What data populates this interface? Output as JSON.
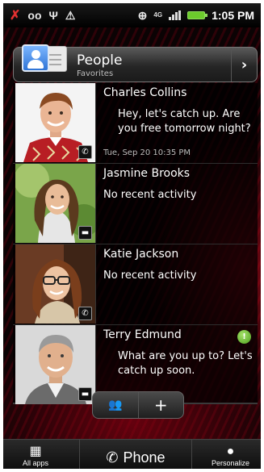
{
  "status_bar": {
    "network_label": "4G",
    "time": "1:05 PM",
    "icons": [
      "missed-call-icon",
      "voicemail-icon",
      "usb-icon",
      "warning-icon",
      "gps-icon",
      "signal-icon",
      "battery-icon"
    ]
  },
  "header": {
    "title": "People",
    "subtitle": "Favorites",
    "icon": "people-app-icon",
    "chevron": "›"
  },
  "contacts": [
    {
      "name": "Charles Collins",
      "message": "Hey, let's catch up. Are you free tomorrow night?",
      "timestamp": "Tue, Sep 20 10:35 PM",
      "badge_icon": "phone-badge-icon",
      "badge_glyph": "✆"
    },
    {
      "name": "Jasmine Brooks",
      "message": "No recent activity",
      "badge_icon": "message-badge-icon",
      "badge_glyph": "▬"
    },
    {
      "name": "Katie Jackson",
      "message": "No recent activity",
      "badge_icon": "phone-badge-icon",
      "badge_glyph": "✆"
    },
    {
      "name": "Terry Edmund",
      "message": "What are you up to? Let's catch up soon.",
      "new_indicator": "!",
      "badge_icon": "message-badge-icon",
      "badge_glyph": "▬"
    }
  ],
  "widget_buttons": {
    "groups_glyph": "👥",
    "add_glyph": "+"
  },
  "launcher": {
    "all_apps_label": "All apps",
    "phone_label": "Phone",
    "personalize_label": "Personalize"
  },
  "colors": {
    "accent_red": "#c80a1e",
    "battery_green": "#6ccb2c",
    "missed_call_red": "#e03030",
    "new_indicator_green": "#4b9d1c"
  }
}
